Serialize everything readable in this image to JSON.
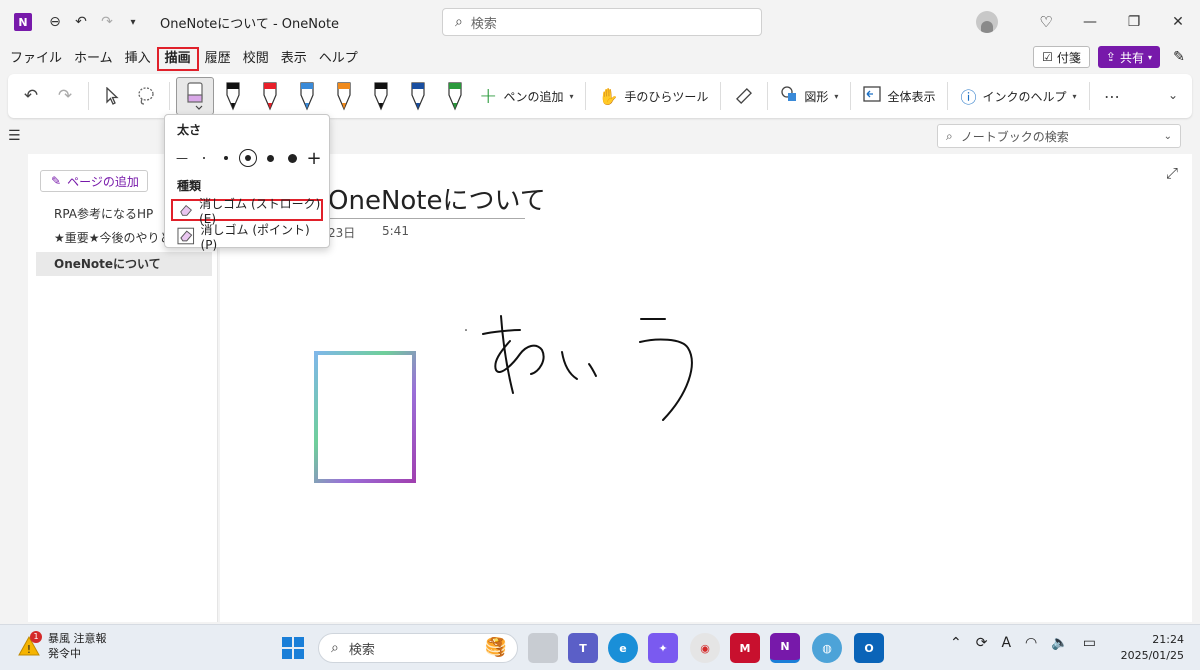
{
  "titlebar": {
    "app_title": "OneNoteについて  -  OneNote",
    "search_placeholder": "検索",
    "logo_letter": "N"
  },
  "menu": {
    "items": [
      "ファイル",
      "ホーム",
      "挿入",
      "描画",
      "履歴",
      "校閲",
      "表示",
      "ヘルプ"
    ],
    "active": "描画",
    "sticky_label": "付箋",
    "share_label": "共有"
  },
  "ribbon": {
    "add_pen_label": "ペンの追加",
    "hand_tool_label": "手のひらツール",
    "shapes_label": "図形",
    "fit_label": "全体表示",
    "ink_help_label": "インクのヘルプ",
    "pen_colors": [
      "#111111",
      "#e8202a",
      "#3a8ad8",
      "#f08a1c",
      "#111111",
      "#1a4fa0",
      "#2b9a3c"
    ]
  },
  "notebook_search_placeholder": "ノートブックの検索",
  "pages": {
    "add_label": "ページの追加",
    "items": [
      "RPA参考になるHP",
      "★重要★今後のやりとり",
      "OneNoteについて"
    ],
    "selected_index": 2
  },
  "page": {
    "title": "OneNoteについて",
    "date_partial": "23日",
    "time": "5:41"
  },
  "dropdown": {
    "thickness_label": "太さ",
    "type_label": "種類",
    "option_stroke": "消しゴム (ストローク)(E)",
    "option_point": "消しゴム (ポイント)(P)"
  },
  "taskbar": {
    "weather_line1": "暴風 注意報",
    "weather_line2": "発令中",
    "alert_count": "1",
    "search_placeholder": "検索",
    "time": "21:24",
    "date": "2025/01/25",
    "ime": "A"
  }
}
